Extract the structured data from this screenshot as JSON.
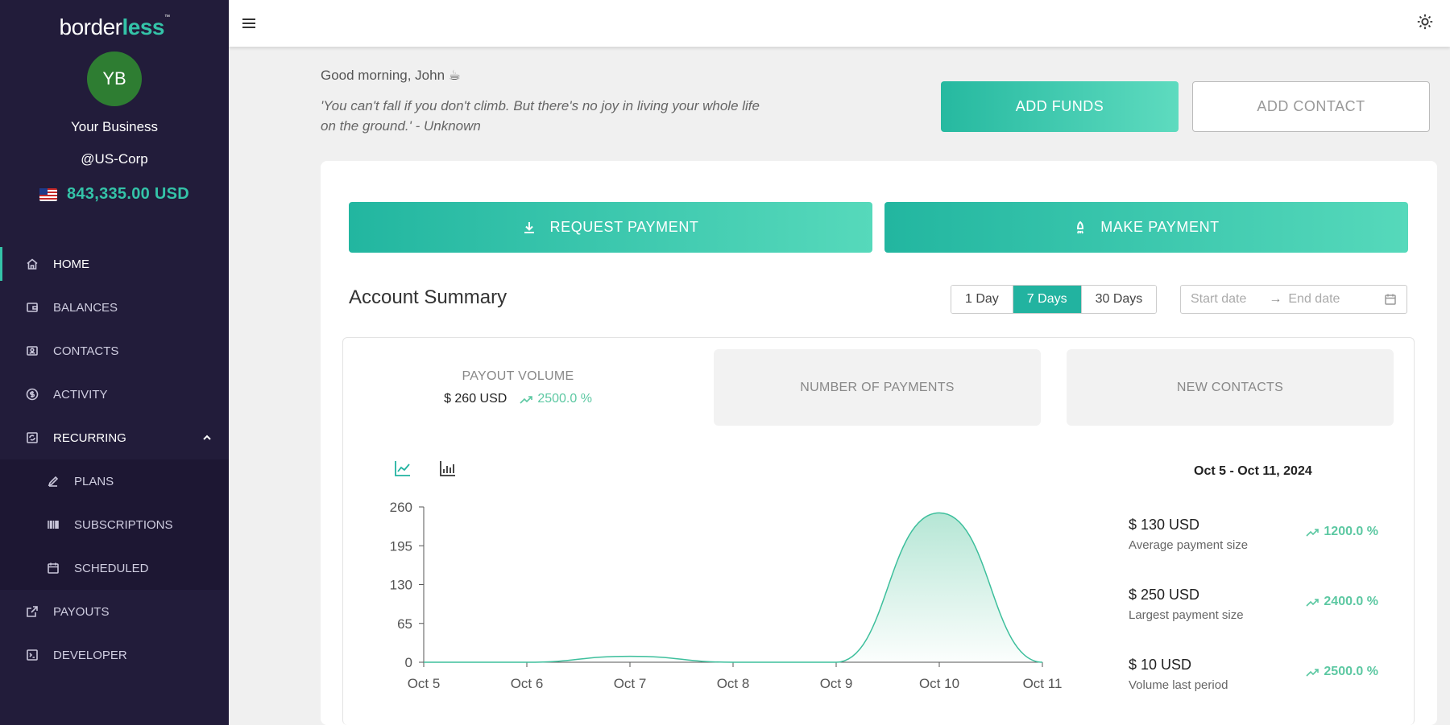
{
  "sidebar": {
    "logo_part1": "border",
    "logo_part2": "less",
    "logo_tm": "™",
    "avatar_initials": "YB",
    "business_name": "Your Business",
    "business_handle": "@US-Corp",
    "balance": "843,335.00 USD",
    "nav": {
      "home": "HOME",
      "balances": "BALANCES",
      "contacts": "CONTACTS",
      "activity": "ACTIVITY",
      "recurring": "RECURRING",
      "plans": "PLANS",
      "subscriptions": "SUBSCRIPTIONS",
      "scheduled": "SCHEDULED",
      "payouts": "PAYOUTS",
      "developer": "DEVELOPER"
    }
  },
  "header": {
    "greeting": "Good morning, John ☕",
    "quote": "'You can't fall if you don't climb. But there's no joy in living your whole life on the ground.' - Unknown",
    "add_funds": "ADD FUNDS",
    "add_contact": "ADD CONTACT"
  },
  "actions": {
    "request_payment": "REQUEST PAYMENT",
    "make_payment": "MAKE PAYMENT"
  },
  "summary": {
    "title": "Account Summary",
    "ranges": [
      "1 Day",
      "7 Days",
      "30 Days"
    ],
    "active_range": "7 Days",
    "start_placeholder": "Start date",
    "end_placeholder": "End date",
    "arrow": "→",
    "tiles": {
      "payout_volume_label": "PAYOUT VOLUME",
      "payout_volume_value": "$ 260 USD",
      "payout_volume_change": "2500.0 %",
      "payments_label": "NUMBER OF PAYMENTS",
      "contacts_label": "NEW CONTACTS"
    },
    "period": "Oct 5 - Oct 11, 2024",
    "metrics": [
      {
        "value": "$ 130 USD",
        "label": "Average payment size",
        "change": "1200.0 %"
      },
      {
        "value": "$ 250 USD",
        "label": "Largest payment size",
        "change": "2400.0 %"
      },
      {
        "value": "$ 10 USD",
        "label": "Volume last period",
        "change": "2500.0 %"
      }
    ]
  },
  "colors": {
    "accent": "#34c3a8",
    "sidebar_bg": "#221c3a",
    "positive": "#5cc8a2"
  },
  "chart_data": {
    "type": "area",
    "categories": [
      "Oct 5",
      "Oct 6",
      "Oct 7",
      "Oct 8",
      "Oct 9",
      "Oct 10",
      "Oct 11"
    ],
    "values": [
      0,
      0,
      10,
      0,
      0,
      250,
      0
    ],
    "yticks": [
      0,
      65,
      130,
      195,
      260
    ],
    "ylim": [
      0,
      260
    ],
    "grid": false,
    "legend": "none"
  }
}
